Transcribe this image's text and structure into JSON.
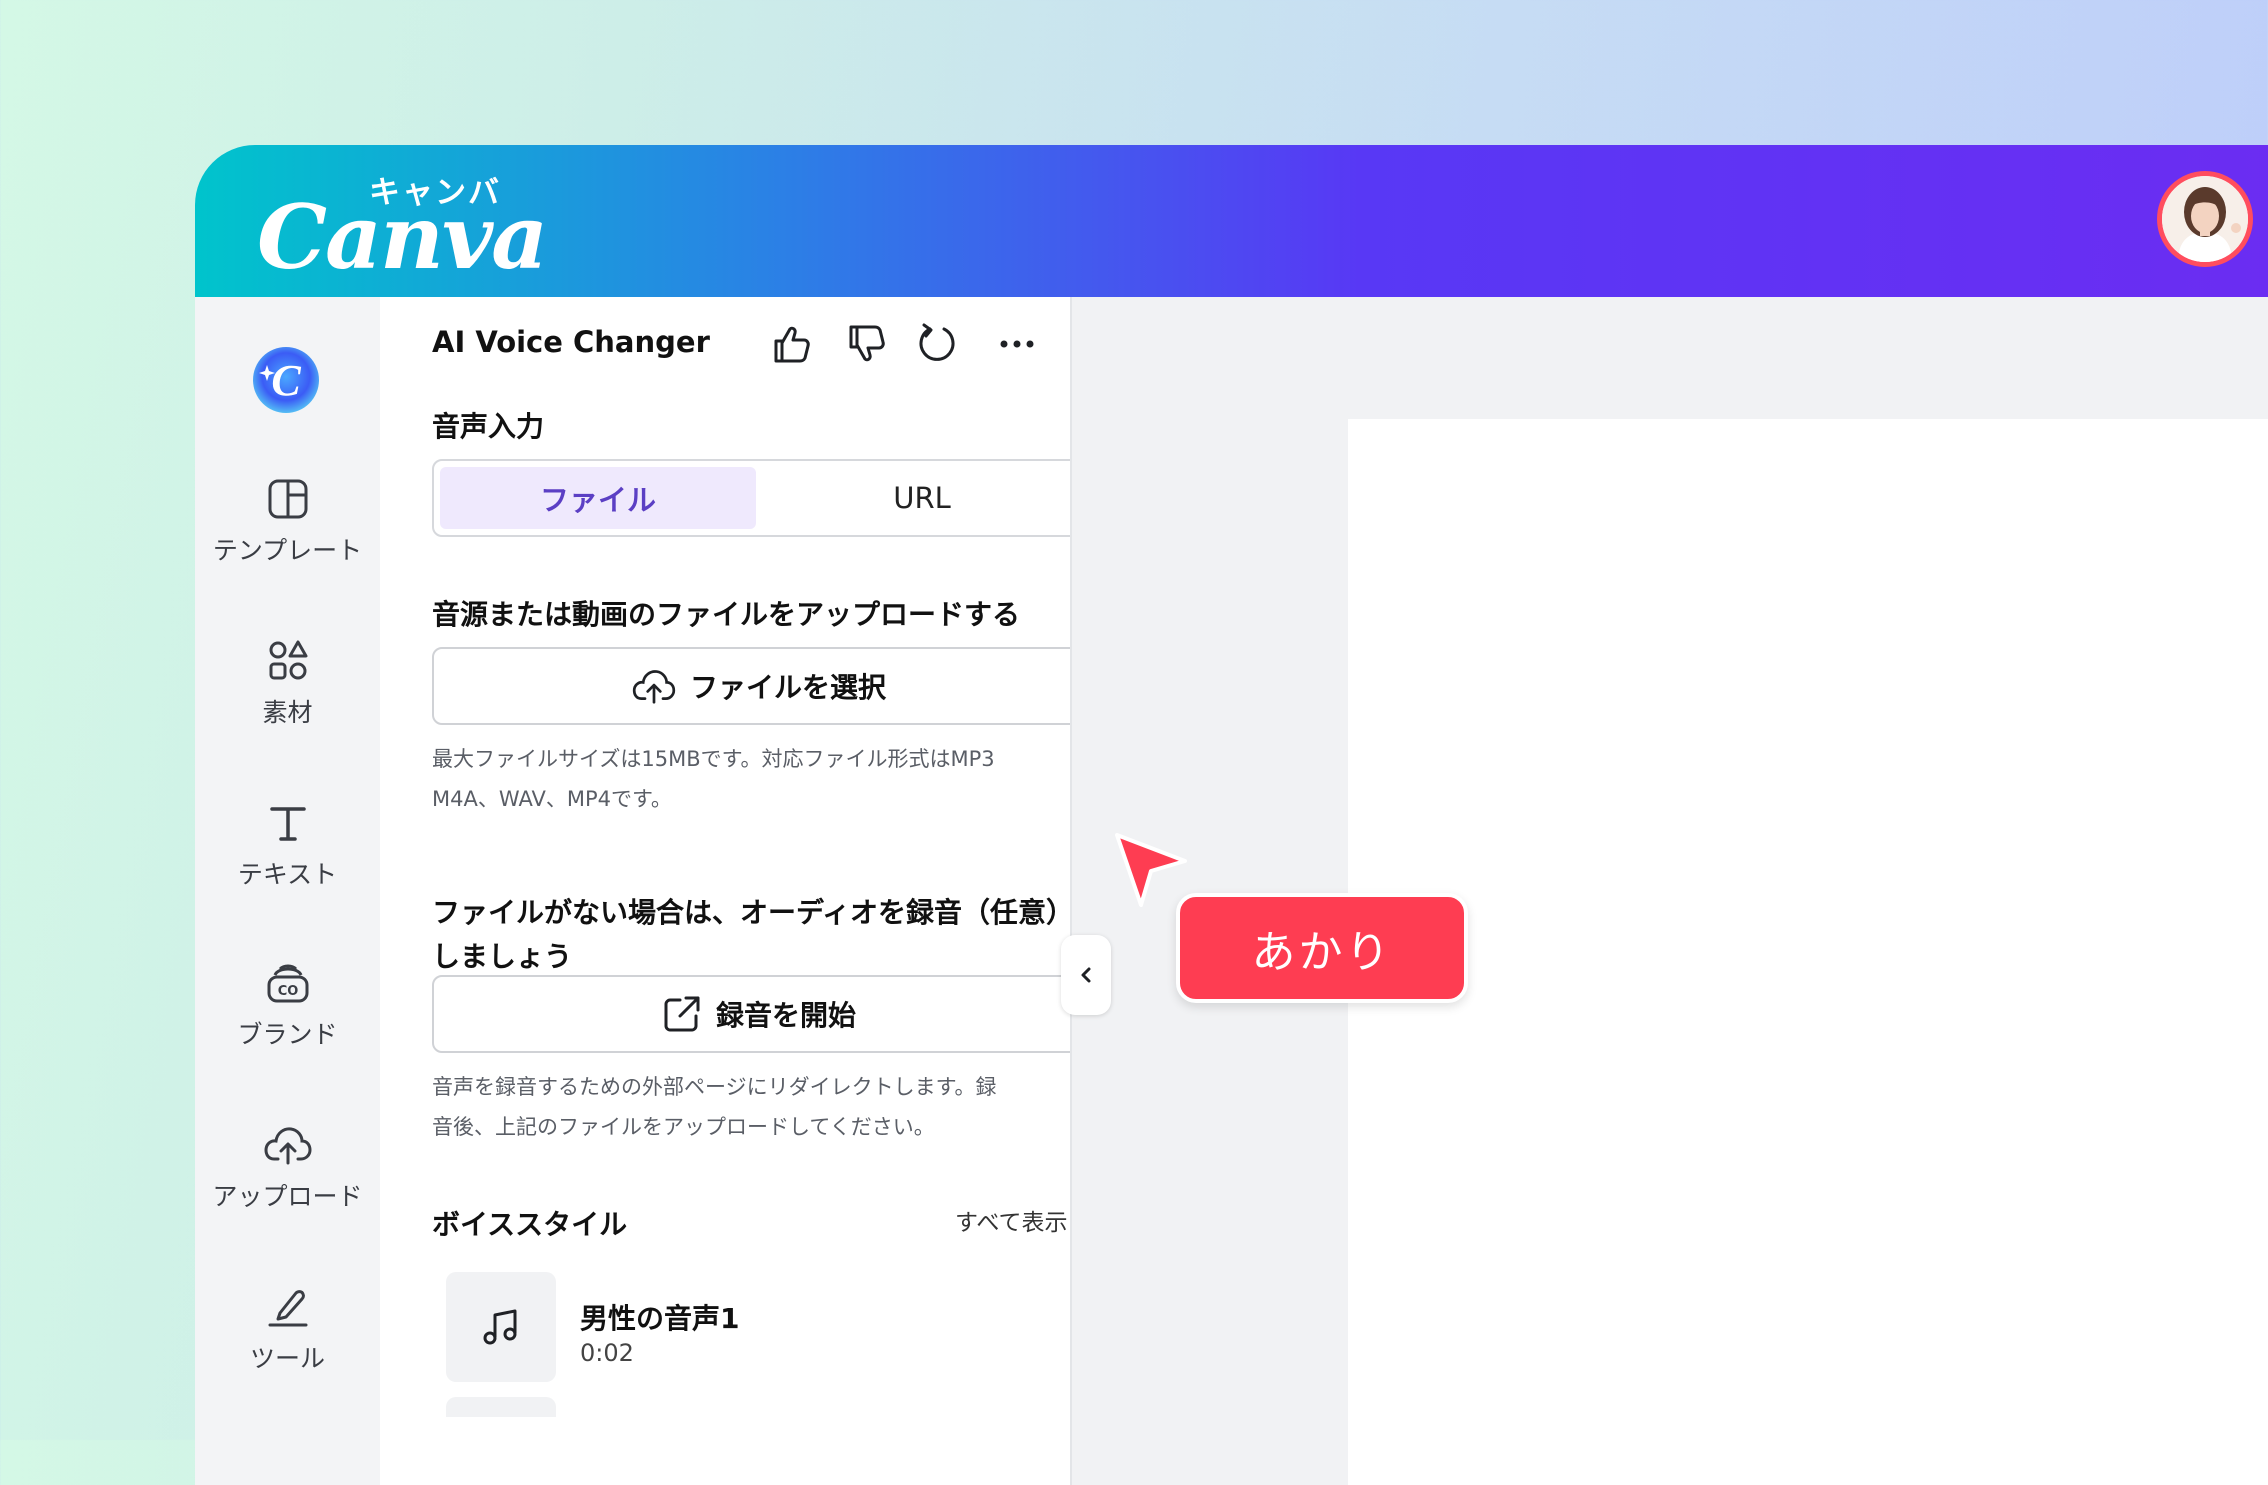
{
  "brand": {
    "kana": "キャンバ",
    "logo": "Canva"
  },
  "sidebar": {
    "items": [
      {
        "label": "テンプレート",
        "icon": "template-icon"
      },
      {
        "label": "素材",
        "icon": "elements-icon"
      },
      {
        "label": "テキスト",
        "icon": "text-icon"
      },
      {
        "label": "ブランド",
        "icon": "brand-icon"
      },
      {
        "label": "アップロード",
        "icon": "upload-icon"
      },
      {
        "label": "ツール",
        "icon": "tools-icon"
      }
    ]
  },
  "panel": {
    "title": "AI Voice Changer",
    "audio_input_label": "音声入力",
    "tabs": {
      "file": "ファイル",
      "url": "URL"
    },
    "upload_label": "音源または動画のファイルをアップロードする",
    "choose_file_button": "ファイルを選択",
    "file_help_line1": "最大ファイルサイズは15MBです。対応ファイル形式はMP3",
    "file_help_line2": "M4A、WAV、MP4です。",
    "record_label_line1": "ファイルがない場合は、オーディオを録音（任意）",
    "record_label_line2": "しましょう",
    "record_button": "録音を開始",
    "record_help_line1": "音声を録音するための外部ページにリダイレクトします。録",
    "record_help_line2": "音後、上記のファイルをアップロードしてください。",
    "voice_style_label": "ボイススタイル",
    "show_all": "すべて表示",
    "voice_item": {
      "name": "男性の音声1",
      "duration": "0:02"
    }
  },
  "cursor_tag": "あかり",
  "colors": {
    "accent": "#5b3fc4",
    "tag": "#fe3d52",
    "avatar_ring": "#ff4d5e"
  }
}
